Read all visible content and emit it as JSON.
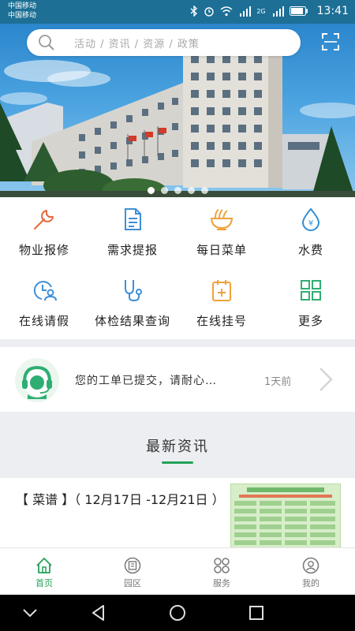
{
  "status_bar": {
    "carrier_1": "中国移动",
    "carrier_2": "中国移动",
    "network_label": "2G",
    "time": "13:41"
  },
  "banner": {
    "search_placeholder": "活动 / 资讯 / 资源 / 政策",
    "slide_count": 5,
    "active_slide": 1
  },
  "services": [
    {
      "label": "物业报修",
      "icon": "wrench-icon",
      "color": "#e26a3c"
    },
    {
      "label": "需求提报",
      "icon": "document-icon",
      "color": "#3e8fd6"
    },
    {
      "label": "每日菜单",
      "icon": "noodle-bowl-icon",
      "color": "#f0a23a"
    },
    {
      "label": "水费",
      "icon": "water-drop-icon",
      "color": "#2f8fd2"
    },
    {
      "label": "在线请假",
      "icon": "clock-person-icon",
      "color": "#3e8fd6"
    },
    {
      "label": "体检结果查询",
      "icon": "stethoscope-icon",
      "color": "#3e8fd6"
    },
    {
      "label": "在线挂号",
      "icon": "calendar-plus-icon",
      "color": "#f0a23a"
    },
    {
      "label": "更多",
      "icon": "grid-icon",
      "color": "#2eae73"
    }
  ],
  "notice": {
    "message": "您的工单已提交，请耐心…",
    "time": "1天前"
  },
  "news": {
    "section_title": "最新资讯",
    "items": [
      {
        "title": "【 菜谱 】（ 12月17日 -12月21日 ）"
      }
    ]
  },
  "tabs": [
    {
      "label": "首页",
      "icon": "home-icon",
      "active": true
    },
    {
      "label": "园区",
      "icon": "building-icon",
      "active": false
    },
    {
      "label": "服务",
      "icon": "services-icon",
      "active": false
    },
    {
      "label": "我的",
      "icon": "user-icon",
      "active": false
    }
  ],
  "colors": {
    "status_bar": "#1d6f95",
    "accent_green": "#24a259",
    "separator": "#eceef1"
  }
}
